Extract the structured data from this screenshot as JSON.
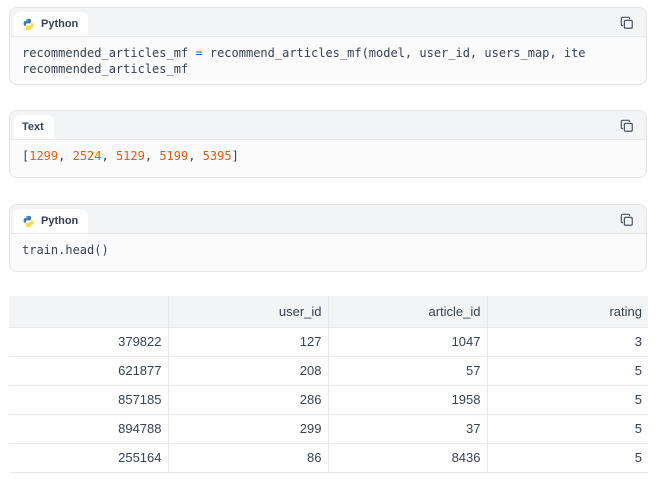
{
  "cells": [
    {
      "language": "Python",
      "code_lines": [
        {
          "tokens": [
            {
              "t": "recommended_articles_mf ",
              "c": ""
            },
            {
              "t": "=",
              "c": "op"
            },
            {
              "t": " recommend_articles_mf(model, user_id, users_map, ite",
              "c": ""
            }
          ]
        },
        {
          "tokens": [
            {
              "t": "recommended_articles_mf",
              "c": ""
            }
          ]
        }
      ]
    },
    {
      "language": "Text",
      "code_lines": [
        {
          "tokens": [
            {
              "t": "[",
              "c": ""
            },
            {
              "t": "1299",
              "c": "num"
            },
            {
              "t": ", ",
              "c": ""
            },
            {
              "t": "2524",
              "c": "num"
            },
            {
              "t": ", ",
              "c": ""
            },
            {
              "t": "5129",
              "c": "num"
            },
            {
              "t": ", ",
              "c": ""
            },
            {
              "t": "5199",
              "c": "num"
            },
            {
              "t": ", ",
              "c": ""
            },
            {
              "t": "5395",
              "c": "num"
            },
            {
              "t": "]",
              "c": ""
            }
          ]
        }
      ]
    },
    {
      "language": "Python",
      "code_lines": [
        {
          "tokens": [
            {
              "t": "train.head()",
              "c": ""
            }
          ]
        }
      ]
    }
  ],
  "table": {
    "columns": [
      "",
      "user_id",
      "article_id",
      "rating"
    ],
    "rows": [
      [
        "379822",
        "127",
        "1047",
        "3"
      ],
      [
        "621877",
        "208",
        "57",
        "5"
      ],
      [
        "857185",
        "286",
        "1958",
        "5"
      ],
      [
        "894788",
        "299",
        "37",
        "5"
      ],
      [
        "255164",
        "86",
        "8436",
        "5"
      ]
    ]
  },
  "icons": {
    "language": "python-icon",
    "copy": "copy-icon"
  },
  "colors": {
    "operator": "#2563eb",
    "number": "#ea580c",
    "python_blue": "#3776ab",
    "python_yellow": "#ffd43b"
  }
}
